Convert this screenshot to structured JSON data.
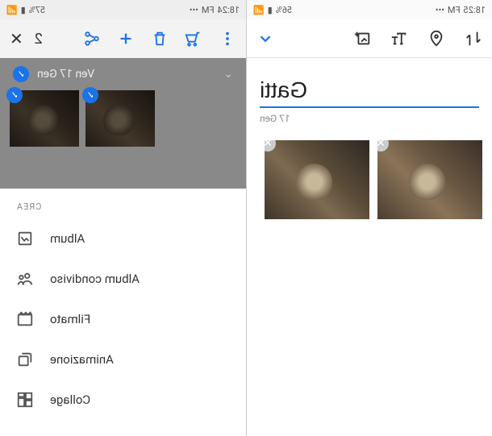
{
  "status_bar": {
    "left": {
      "time": "18:25",
      "fm": "FM"
    },
    "right": {
      "battery": "56%"
    }
  },
  "status_bar_right": {
    "left": {
      "time": "18:24",
      "fm": "FM"
    },
    "right": {
      "battery": "57%"
    }
  },
  "left_pane": {
    "title": "Gatti",
    "date": "17 Gen",
    "photos": [
      {
        "id": "photo-1"
      },
      {
        "id": "photo-2"
      }
    ]
  },
  "right_pane": {
    "selection_count": "2",
    "date": "Ven 17 Gen",
    "thumbs": [
      {
        "id": "t1"
      },
      {
        "id": "t2"
      }
    ],
    "sheet": {
      "title": "CREA",
      "items": [
        {
          "icon": "album-icon",
          "label": "Album"
        },
        {
          "icon": "shared-album-icon",
          "label": "Album condiviso"
        },
        {
          "icon": "movie-icon",
          "label": "Filmato"
        },
        {
          "icon": "animation-icon",
          "label": "Animazione"
        },
        {
          "icon": "collage-icon",
          "label": "Collage"
        }
      ]
    }
  },
  "icons": {
    "expand_down": "⌄",
    "close": "✕",
    "check": "✓"
  }
}
